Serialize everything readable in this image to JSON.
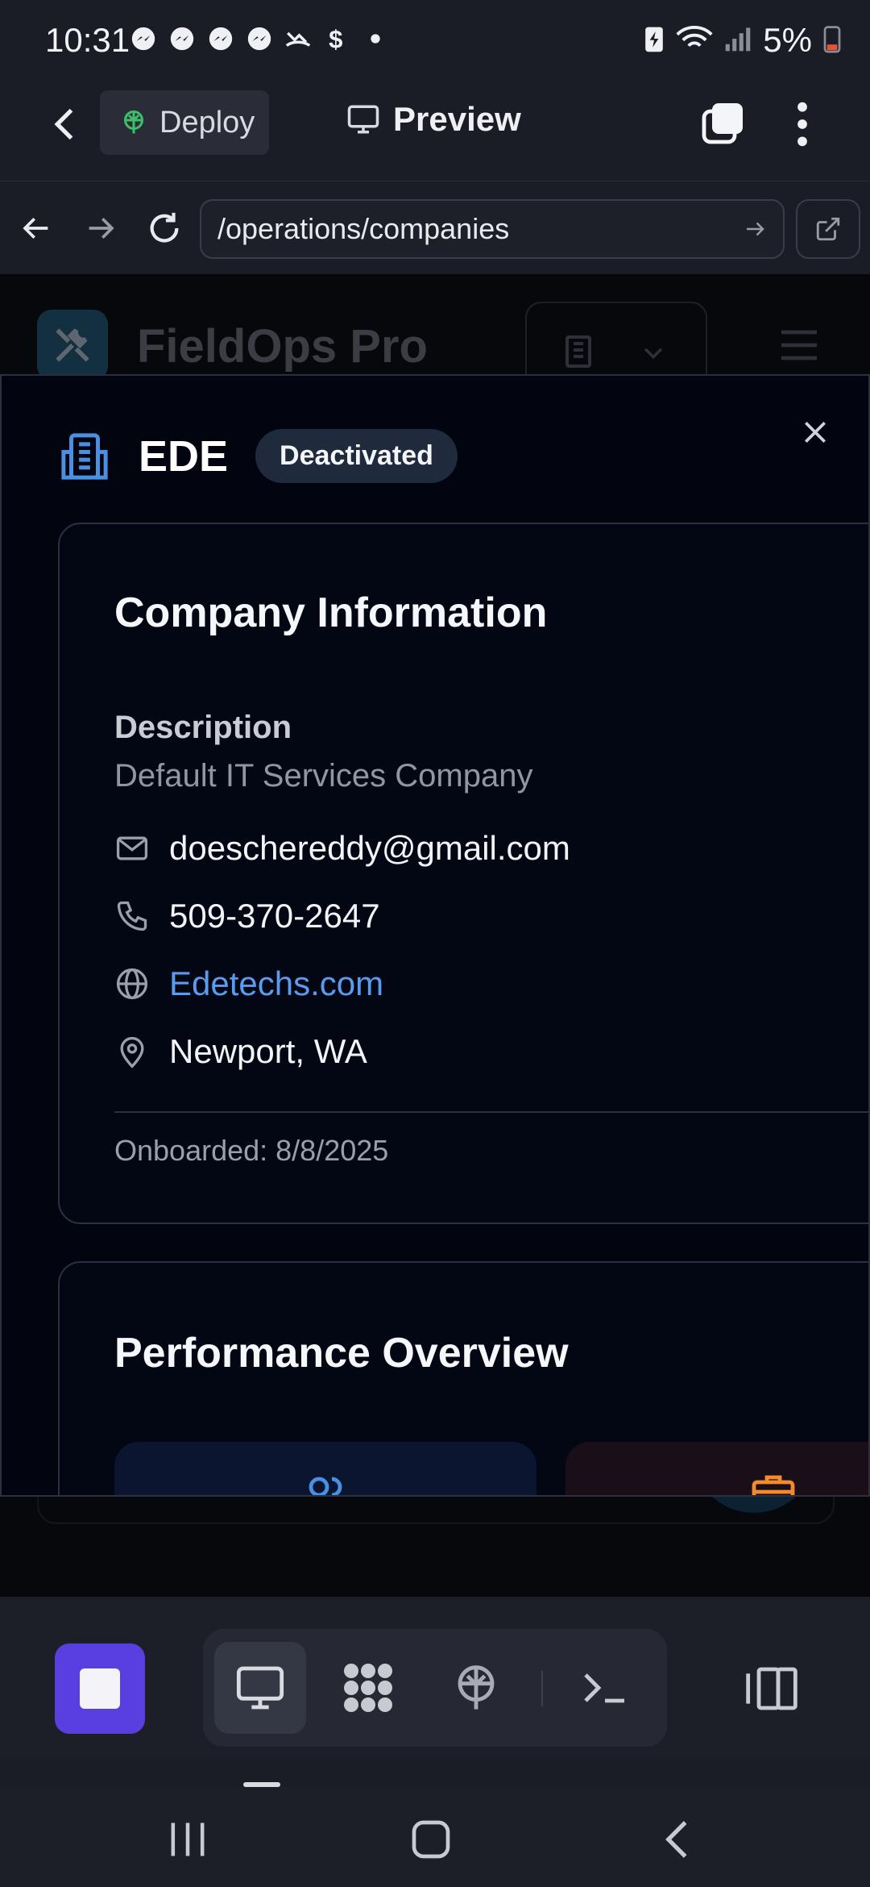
{
  "status_bar": {
    "time": "10:31",
    "battery": "5%",
    "notification_icons": [
      "messenger-icon",
      "messenger-icon",
      "messenger-icon",
      "messenger-icon",
      "missed-call-icon",
      "dollar-icon",
      "dot-icon"
    ]
  },
  "app_bar": {
    "deploy_label": "Deploy",
    "preview_label": "Preview"
  },
  "browser": {
    "url": "/operations/companies"
  },
  "background_page": {
    "brand": "FieldOps Pro"
  },
  "modal": {
    "title": "EDE",
    "status": "Deactivated",
    "company_info": {
      "heading": "Company Information",
      "description_label": "Description",
      "description": "Default IT Services Company",
      "email": "doeschereddy@gmail.com",
      "phone": "509-370-2647",
      "website": "Edetechs.com",
      "location": "Newport, WA",
      "onboarded": "Onboarded: 8/8/2025"
    },
    "performance": {
      "heading": "Performance Overview"
    }
  },
  "colors": {
    "accent_purple": "#5a3fe0",
    "link_blue": "#5b9bef",
    "icon_blue": "#4a90e2",
    "icon_orange": "#f28a2e"
  }
}
